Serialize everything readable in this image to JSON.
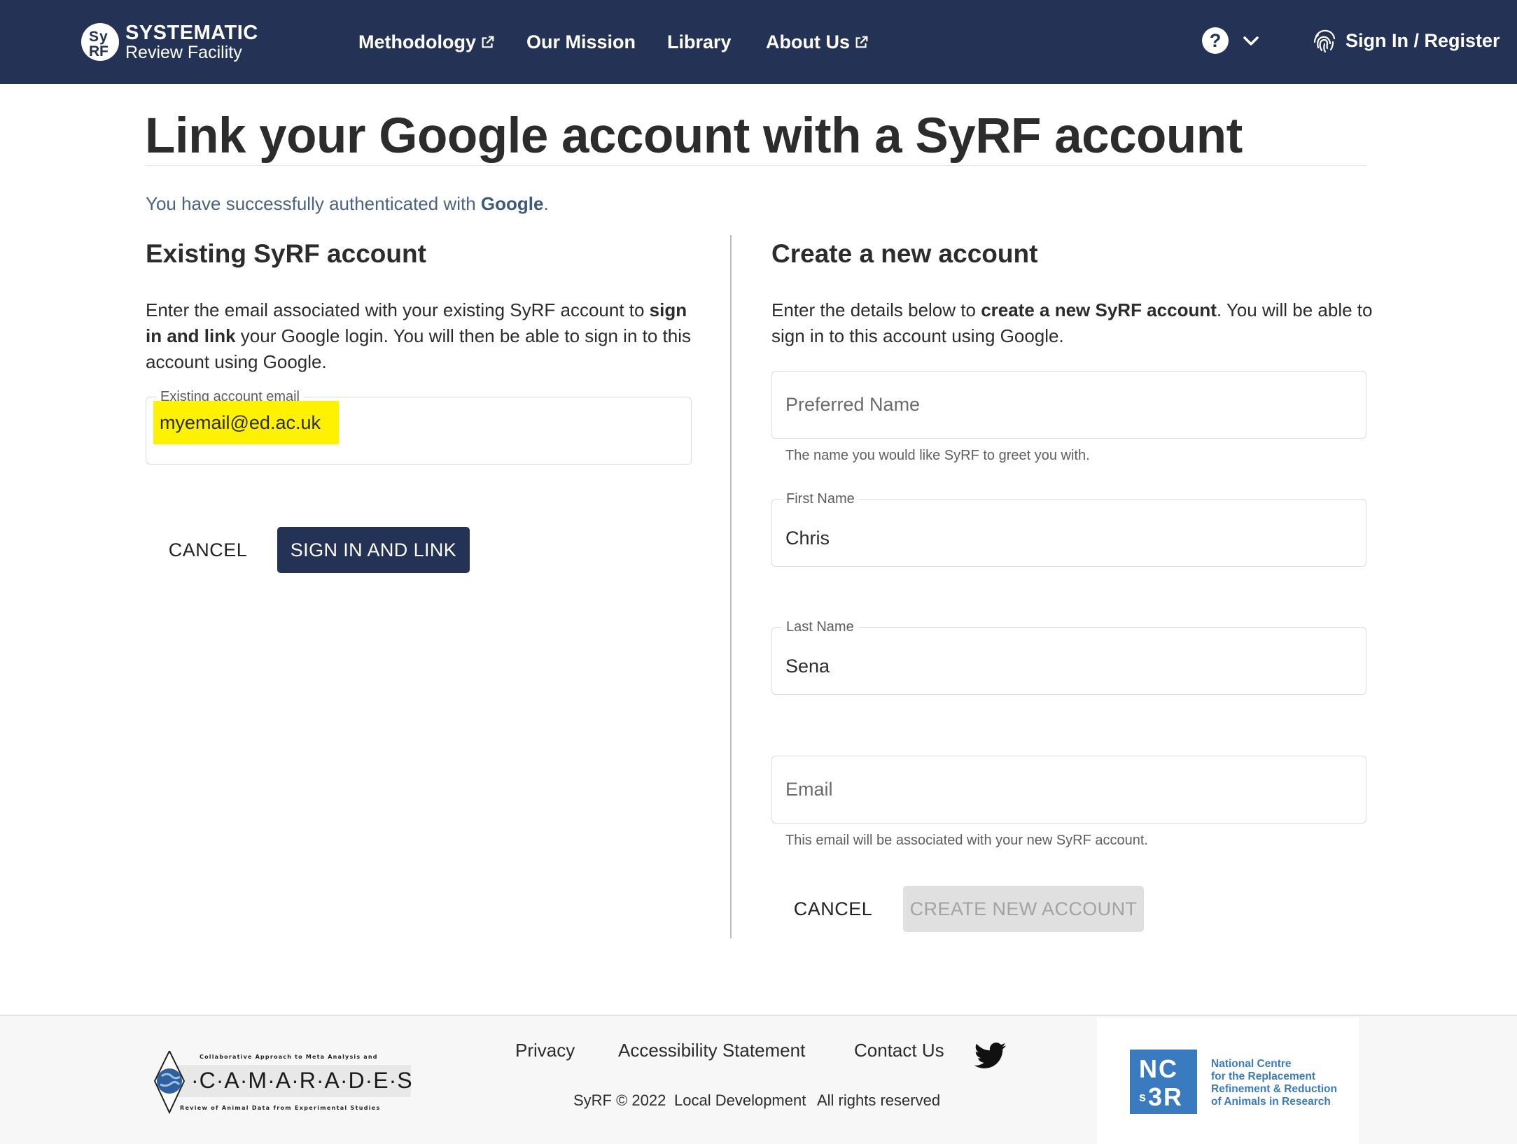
{
  "header": {
    "brand": {
      "line1": "SYSTEMATIC",
      "line2": "Review Facility"
    },
    "nav": [
      {
        "label": "Methodology",
        "external": true
      },
      {
        "label": "Our Mission",
        "external": false
      },
      {
        "label": "Library",
        "external": false
      },
      {
        "label": "About Us",
        "external": true
      }
    ],
    "help_icon": "question-circle-icon",
    "sign_in_label": "Sign In / Register"
  },
  "page": {
    "title": "Link your Google account with a SyRF account",
    "auth_message": {
      "prefix": "You have successfully authenticated with ",
      "provider": "Google",
      "suffix": "."
    }
  },
  "existing": {
    "title": "Existing SyRF account",
    "desc": {
      "p1": "Enter the email associated with your existing SyRF account to ",
      "b1": "sign in and link",
      "p2": " your Google login. You will then be able to sign in to this account using Google."
    },
    "email_label": "Existing account email",
    "email_value": "myemail@ed.ac.uk",
    "cancel_label": "CANCEL",
    "submit_label": "SIGN IN AND LINK"
  },
  "create": {
    "title": "Create a new account",
    "desc": {
      "p1": "Enter the details below to ",
      "b1": "create a new SyRF account",
      "p2": ". You will be able to sign in to this account using Google."
    },
    "preferred_name": {
      "placeholder": "Preferred Name",
      "hint": "The name you would like SyRF to greet you with."
    },
    "first_name": {
      "label": "First Name",
      "value": "Chris"
    },
    "last_name": {
      "label": "Last Name",
      "value": "Sena"
    },
    "email": {
      "placeholder": "Email",
      "hint": "This email will be associated with your new SyRF account."
    },
    "cancel_label": "CANCEL",
    "submit_label": "CREATE NEW ACCOUNT"
  },
  "footer": {
    "camarades": {
      "top": "Collaborative Approach to Meta Analysis and",
      "name": "·C·A·M·A·R·A·D·E·S·",
      "bottom": "Review of Animal Data from Experimental Studies"
    },
    "links": [
      "Privacy",
      "Accessibility Statement",
      "Contact Us"
    ],
    "twitter_icon": "twitter-bird-icon",
    "meta": [
      "SyRF © 2022",
      "Local Development",
      "All rights reserved"
    ],
    "nc3rs": {
      "mark_top": "NC",
      "mark_bottom": "3R",
      "mark_sup": "s",
      "lines": [
        "National Centre",
        "for the Replacement",
        "Refinement & Reduction",
        "of Animals in Research"
      ]
    }
  },
  "colors": {
    "header_bg": "#243255",
    "primary_button": "#243255",
    "highlight": "#fff200",
    "nc3rs_blue": "#3a7bbf",
    "auth_text": "#4a6382"
  }
}
